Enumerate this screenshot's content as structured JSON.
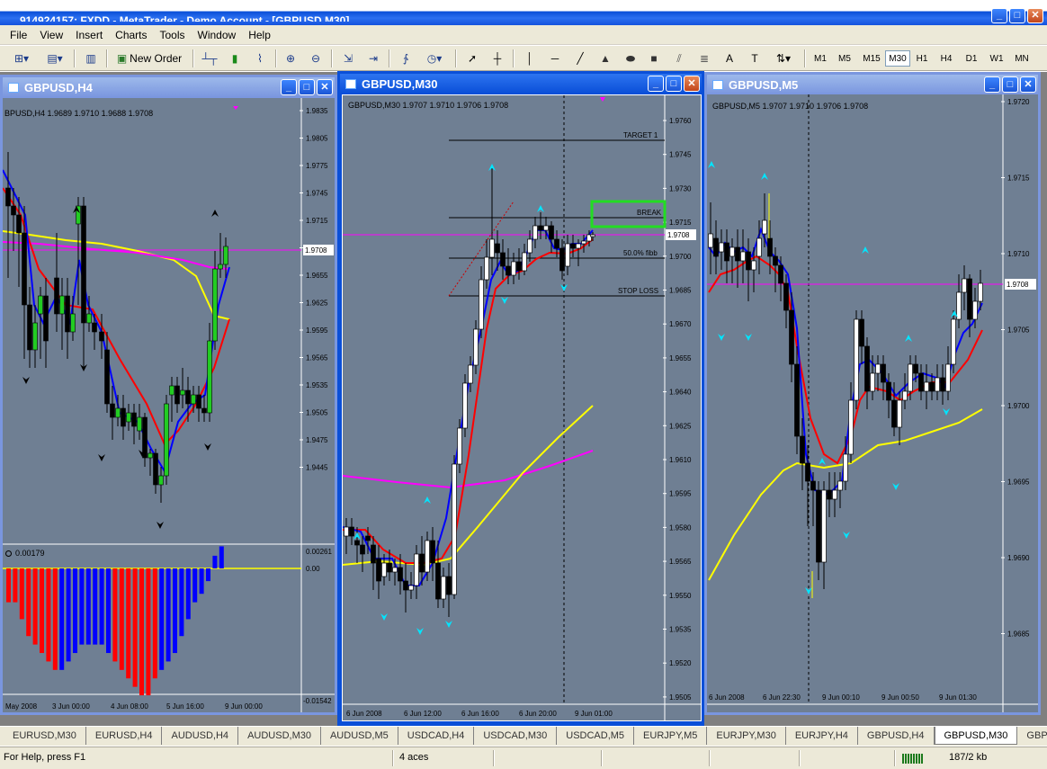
{
  "app": {
    "title": "914924157: FXDD - MetaTrader - Demo Account - [GBPUSD,M30]"
  },
  "menu": [
    "File",
    "View",
    "Insert",
    "Charts",
    "Tools",
    "Window",
    "Help"
  ],
  "toolbar": {
    "new_order": "New Order",
    "timeframes": [
      "M1",
      "M5",
      "M15",
      "M30",
      "H1",
      "H4",
      "D1",
      "W1",
      "MN"
    ],
    "selected_timeframe": "M30"
  },
  "windows": {
    "h4": {
      "title": "GBPUSD,H4",
      "info": "BPUSD,H4  1.9689 1.9710 1.9688 1.9708",
      "price_ticks": [
        "1.9835",
        "1.9805",
        "1.9775",
        "1.9745",
        "1.9715",
        "1.9685",
        "1.9655",
        "1.9625",
        "1.9595",
        "1.9565",
        "1.9535",
        "1.9505",
        "1.9475",
        "1.9445"
      ],
      "current_price": "1.9708",
      "osc_label": "0.00179",
      "osc_ticks": [
        "0.00261",
        "0.00",
        "-0.01542"
      ],
      "time_labels": [
        "May 2008",
        "3 Jun 00:00",
        "4 Jun 08:00",
        "5 Jun 16:00",
        "9 Jun 00:00"
      ],
      "osc_values": [
        -0.004,
        -0.004,
        -0.006,
        -0.008,
        -0.009,
        -0.01,
        -0.011,
        -0.012,
        -0.012,
        -0.011,
        -0.01,
        -0.009,
        -0.009,
        -0.009,
        -0.009,
        -0.01,
        -0.011,
        -0.012,
        -0.013,
        -0.014,
        -0.015,
        -0.015,
        -0.013,
        -0.012,
        -0.011,
        -0.01,
        -0.008,
        -0.006,
        -0.004,
        -0.003,
        -0.0015,
        0.0015,
        0.00261
      ]
    },
    "m30": {
      "title": "GBPUSD,M30",
      "info": "GBPUSD,M30  1.9707 1.9710 1.9706 1.9708",
      "price_ticks": [
        "1.9760",
        "1.9745",
        "1.9730",
        "1.9715",
        "1.9700",
        "1.9685",
        "1.9670",
        "1.9655",
        "1.9640",
        "1.9625",
        "1.9610",
        "1.9595",
        "1.9580",
        "1.9565",
        "1.9550",
        "1.9535",
        "1.9520",
        "1.9505"
      ],
      "current_price": "1.9708",
      "levels": {
        "target": "TARGET 1",
        "break": "BREAK",
        "fibb": "50.0% fibb",
        "stop": "STOP LOSS"
      },
      "time_labels": [
        "6 Jun 2008",
        "6 Jun 12:00",
        "6 Jun 16:00",
        "6 Jun 20:00",
        "9 Jun 01:00"
      ]
    },
    "m5": {
      "title": "GBPUSD,M5",
      "info": "GBPUSD,M5  1.9707 1.9710 1.9706 1.9708",
      "price_ticks": [
        "1.9720",
        "1.9715",
        "1.9710",
        "1.9705",
        "1.9700",
        "1.9695",
        "1.9690",
        "1.9685"
      ],
      "current_price": "1.9708",
      "time_labels": [
        "6 Jun 2008",
        "6 Jun 22:30",
        "9 Jun 00:10",
        "9 Jun 00:50",
        "9 Jun 01:30"
      ]
    }
  },
  "tabs": [
    "EURUSD,M30",
    "EURUSD,H4",
    "AUDUSD,H4",
    "AUDUSD,M30",
    "AUDUSD,M5",
    "USDCAD,H4",
    "USDCAD,M30",
    "USDCAD,M5",
    "EURJPY,M5",
    "EURJPY,M30",
    "EURJPY,H4",
    "GBPUSD,H4",
    "GBPUSD,M30",
    "GBPUSD,"
  ],
  "selected_tab": "GBPUSD,M30",
  "status": {
    "help": "For Help, press F1",
    "profile": "4 aces",
    "traffic": "187/2 kb"
  },
  "colors": {
    "chart_bg": "#6f7f93",
    "active_border": "#0a4fd8",
    "bull": "#ffffff",
    "bull_h4": "#22cc22",
    "ema_blue": "#0000ff",
    "ema_red": "#ff0000",
    "ma_yellow": "#ffff00",
    "ma_magenta": "#ff00ff",
    "arrow_cyan": "#00e5ff",
    "osc_neg_red": "#ff0000",
    "osc_neg_blue": "#0000ff"
  }
}
